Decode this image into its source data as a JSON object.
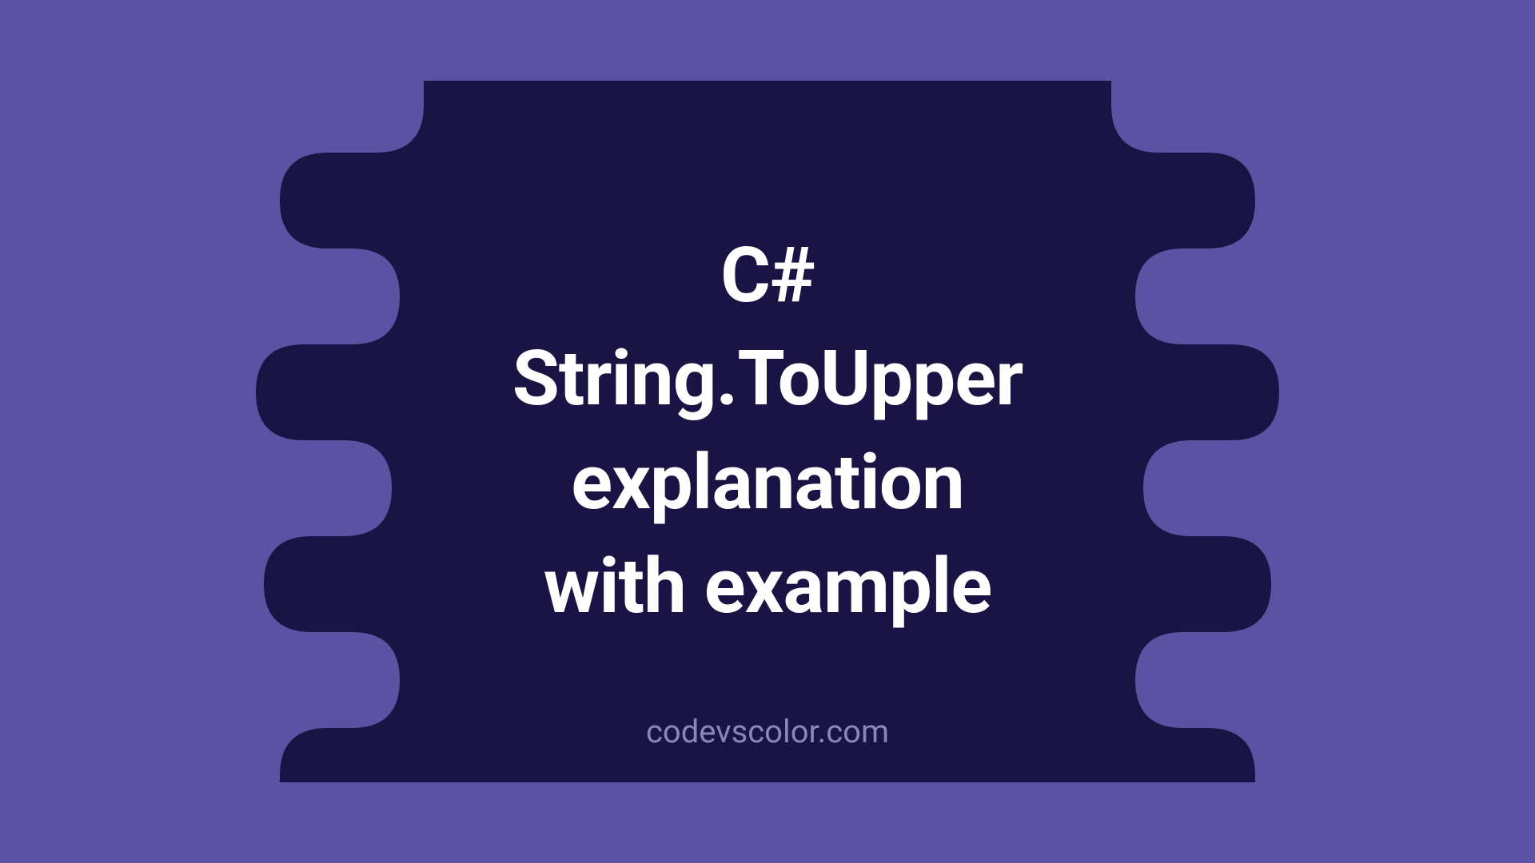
{
  "title": {
    "line1": "C#",
    "line2": "String.ToUpper",
    "line3": "explanation",
    "line4": "with example"
  },
  "watermark": "codevscolor.com",
  "colors": {
    "background": "#5b52a3",
    "blob": "#1a1444",
    "text": "#ffffff",
    "watermark": "#8b86b8"
  }
}
